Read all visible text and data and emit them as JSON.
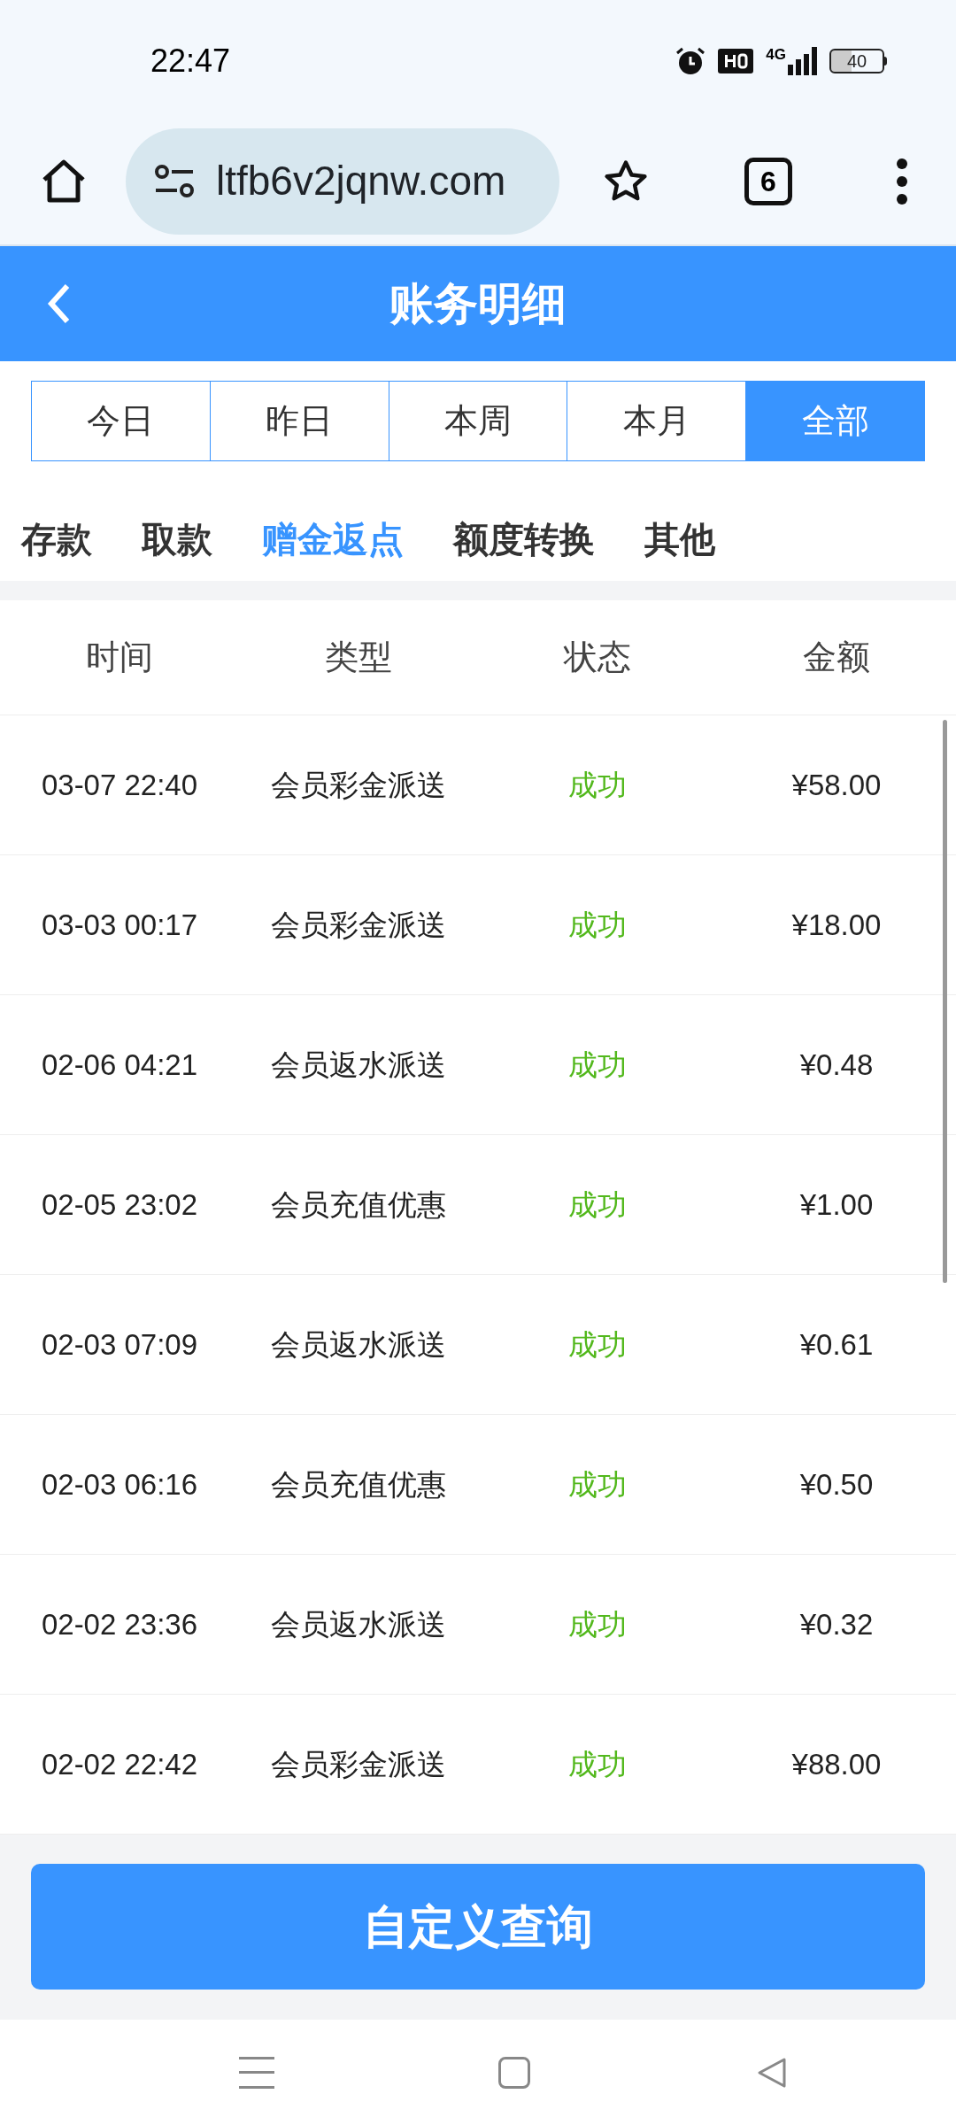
{
  "status_bar": {
    "time": "22:47",
    "network": "4G",
    "battery": "40"
  },
  "browser": {
    "url": "ltfb6v2jqnw.com",
    "tab_count": "6"
  },
  "header": {
    "title": "账务明细"
  },
  "period_tabs": [
    {
      "label": "今日",
      "selected": false
    },
    {
      "label": "昨日",
      "selected": false
    },
    {
      "label": "本周",
      "selected": false
    },
    {
      "label": "本月",
      "selected": false
    },
    {
      "label": "全部",
      "selected": true
    }
  ],
  "category_tabs": [
    {
      "label": "存款",
      "selected": false
    },
    {
      "label": "取款",
      "selected": false
    },
    {
      "label": "赠金返点",
      "selected": true
    },
    {
      "label": "额度转换",
      "selected": false
    },
    {
      "label": "其他",
      "selected": false
    }
  ],
  "table": {
    "columns": [
      "时间",
      "类型",
      "状态",
      "金额"
    ],
    "rows": [
      {
        "time": "03-07 22:40",
        "type": "会员彩金派送",
        "status": "成功",
        "amount": "¥58.00"
      },
      {
        "time": "03-03 00:17",
        "type": "会员彩金派送",
        "status": "成功",
        "amount": "¥18.00"
      },
      {
        "time": "02-06 04:21",
        "type": "会员返水派送",
        "status": "成功",
        "amount": "¥0.48"
      },
      {
        "time": "02-05 23:02",
        "type": "会员充值优惠",
        "status": "成功",
        "amount": "¥1.00"
      },
      {
        "time": "02-03 07:09",
        "type": "会员返水派送",
        "status": "成功",
        "amount": "¥0.61"
      },
      {
        "time": "02-03 06:16",
        "type": "会员充值优惠",
        "status": "成功",
        "amount": "¥0.50"
      },
      {
        "time": "02-02 23:36",
        "type": "会员返水派送",
        "status": "成功",
        "amount": "¥0.32"
      },
      {
        "time": "02-02 22:42",
        "type": "会员彩金派送",
        "status": "成功",
        "amount": "¥88.00"
      }
    ]
  },
  "query_button": "自定义查询"
}
